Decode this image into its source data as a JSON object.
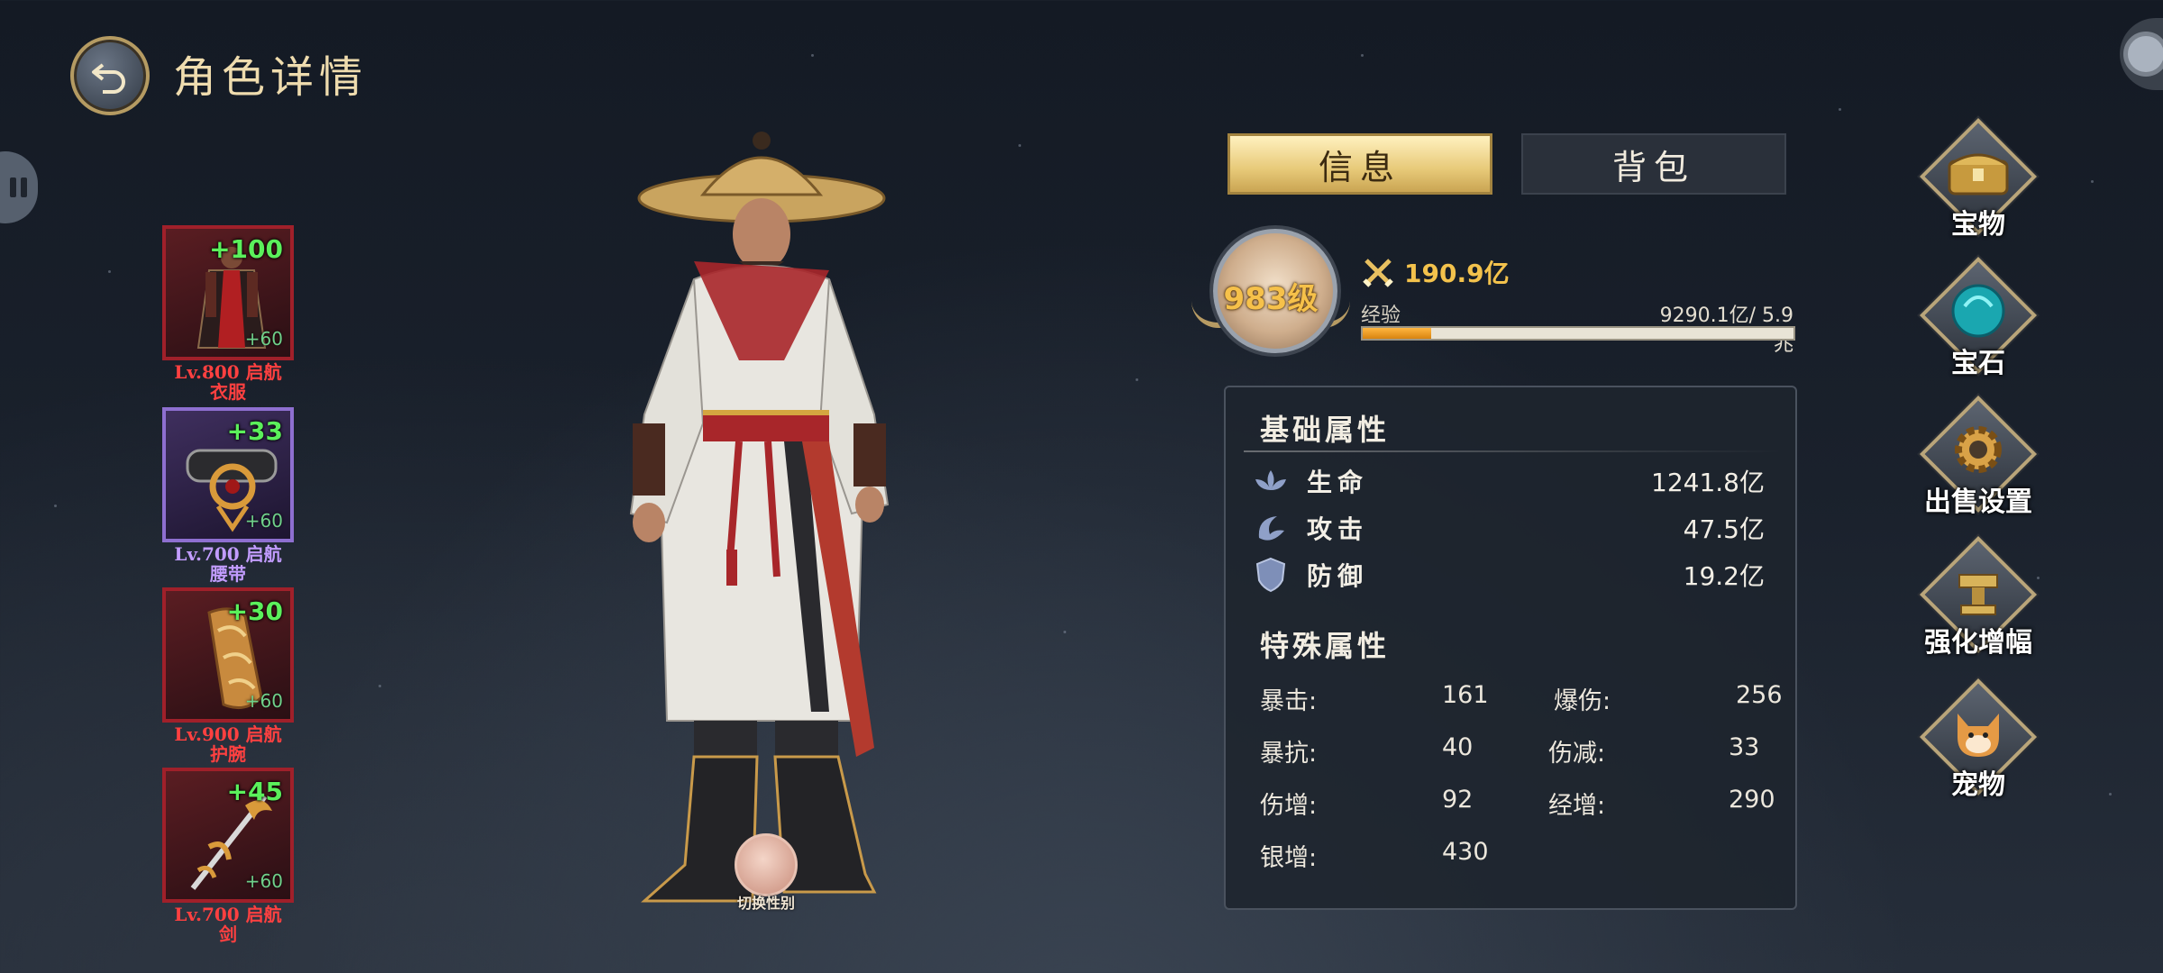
{
  "header": {
    "title": "角色详情"
  },
  "equipment": [
    {
      "plus": "+100",
      "sub": "+60",
      "level_line1": "Lv.800 启航",
      "level_line2": "衣服",
      "rarity": "red",
      "icon": "robe-icon"
    },
    {
      "plus": "+33",
      "sub": "+60",
      "level_line1": "Lv.700 启航",
      "level_line2": "腰带",
      "rarity": "purple",
      "icon": "belt-icon"
    },
    {
      "plus": "+30",
      "sub": "+60",
      "level_line1": "Lv.900 启航",
      "level_line2": "护腕",
      "rarity": "red",
      "icon": "bracer-icon"
    },
    {
      "plus": "+45",
      "sub": "+60",
      "level_line1": "Lv.700 启航",
      "level_line2": "剑",
      "rarity": "red",
      "icon": "sword-icon"
    }
  ],
  "character": {
    "switch_gender_label": "切换性别"
  },
  "tabs": {
    "info": "信息",
    "bag": "背包"
  },
  "profile": {
    "level": "983级",
    "power": "190.9亿",
    "exp_label": "经验",
    "exp_value": "9290.1亿/ 5.9兆",
    "exp_progress": 0.16
  },
  "stats": {
    "basic_title": "基础属性",
    "basic": [
      {
        "name": "生命",
        "value": "1241.8亿",
        "icon": "lotus-icon"
      },
      {
        "name": "攻击",
        "value": "47.5亿",
        "icon": "attack-swirl-icon"
      },
      {
        "name": "防御",
        "value": "19.2亿",
        "icon": "shield-icon"
      }
    ],
    "special_title": "特殊属性",
    "special": [
      {
        "label": "暴击:",
        "value": "161"
      },
      {
        "label": "爆伤:",
        "value": "256"
      },
      {
        "label": "暴抗:",
        "value": "40"
      },
      {
        "label": "伤减:",
        "value": "33"
      },
      {
        "label": "伤增:",
        "value": "92"
      },
      {
        "label": "经增:",
        "value": "290"
      },
      {
        "label": "银增:",
        "value": "430"
      }
    ]
  },
  "menu": [
    {
      "label": "宝物",
      "icon": "treasure-chest-icon"
    },
    {
      "label": "宝石",
      "icon": "gem-icon"
    },
    {
      "label": "出售设置",
      "icon": "gear-icon"
    },
    {
      "label": "强化增幅",
      "icon": "anvil-icon"
    },
    {
      "label": "宠物",
      "icon": "pet-dog-icon"
    }
  ],
  "colors": {
    "accent_gold": "#f3c24c",
    "rarity_red": "#a0202a",
    "rarity_purple": "#8e6fd0",
    "plus_green": "#5bf05b"
  }
}
